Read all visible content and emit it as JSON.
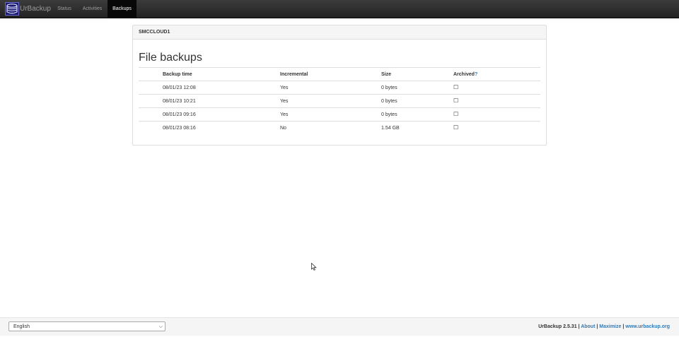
{
  "app": {
    "brand": "UrBackup",
    "nav": {
      "status": "Status",
      "activities": "Activities",
      "backups": "Backups"
    }
  },
  "panel": {
    "client_name": "SMCCLOUD1",
    "section_title": "File backups",
    "columns": {
      "backup_time": "Backup time",
      "incremental": "Incremental",
      "size": "Size",
      "archived": "Archived",
      "archived_help": "?"
    },
    "rows": [
      {
        "time": "08/01/23 12:08",
        "incremental": "Yes",
        "size": "0 bytes",
        "archived": "☐"
      },
      {
        "time": "08/01/23 10:21",
        "incremental": "Yes",
        "size": "0 bytes",
        "archived": "☐"
      },
      {
        "time": "08/01/23 09:16",
        "incremental": "Yes",
        "size": "0 bytes",
        "archived": "☐"
      },
      {
        "time": "08/01/23 08:16",
        "incremental": "No",
        "size": "1.54 GB",
        "archived": "☐"
      }
    ]
  },
  "footer": {
    "language": "English",
    "version": "UrBackup 2.5.31",
    "sep": " | ",
    "about": "About",
    "maximize": "Maximize",
    "website": "www.urbackup.org"
  },
  "colors": {
    "navbar": "#222222",
    "link": "#337ab7"
  }
}
